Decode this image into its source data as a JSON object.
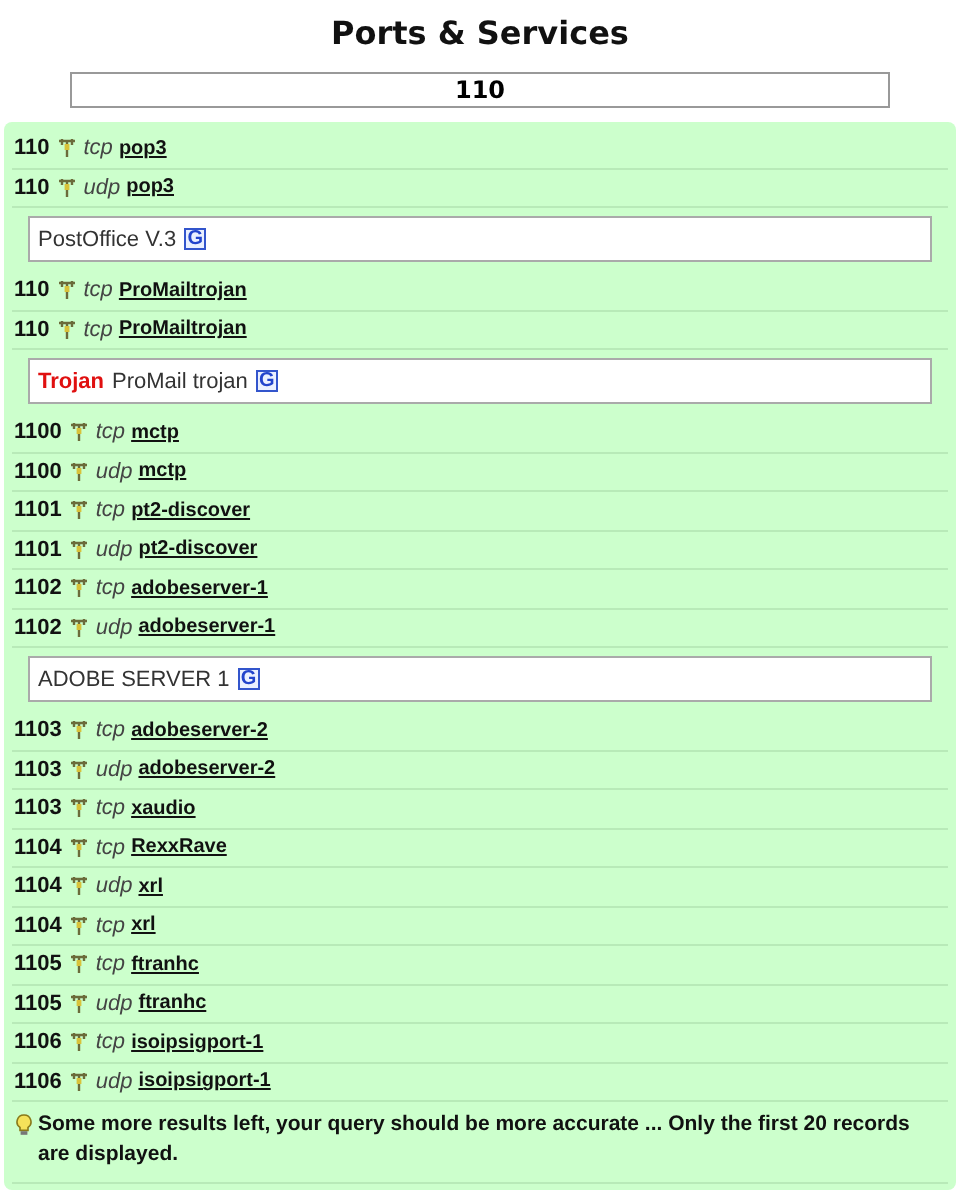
{
  "title": "Ports & Services",
  "search": {
    "value": "110"
  },
  "records": [
    {
      "port": "110",
      "protocol": "tcp",
      "service": "pop3"
    },
    {
      "port": "110",
      "protocol": "udp",
      "service": "pop3",
      "description": {
        "text": "PostOffice V.3",
        "link": "G"
      }
    },
    {
      "port": "110",
      "protocol": "tcp",
      "service": "ProMailtrojan"
    },
    {
      "port": "110",
      "protocol": "tcp",
      "service": "ProMailtrojan",
      "description": {
        "tag": "Trojan",
        "text": "ProMail trojan",
        "link": "G"
      }
    },
    {
      "port": "1100",
      "protocol": "tcp",
      "service": "mctp"
    },
    {
      "port": "1100",
      "protocol": "udp",
      "service": "mctp"
    },
    {
      "port": "1101",
      "protocol": "tcp",
      "service": "pt2-discover"
    },
    {
      "port": "1101",
      "protocol": "udp",
      "service": "pt2-discover"
    },
    {
      "port": "1102",
      "protocol": "tcp",
      "service": "adobeserver-1"
    },
    {
      "port": "1102",
      "protocol": "udp",
      "service": "adobeserver-1",
      "description": {
        "text": "ADOBE SERVER 1",
        "link": "G"
      }
    },
    {
      "port": "1103",
      "protocol": "tcp",
      "service": "adobeserver-2"
    },
    {
      "port": "1103",
      "protocol": "udp",
      "service": "adobeserver-2"
    },
    {
      "port": "1103",
      "protocol": "tcp",
      "service": "xaudio"
    },
    {
      "port": "1104",
      "protocol": "tcp",
      "service": "RexxRave"
    },
    {
      "port": "1104",
      "protocol": "udp",
      "service": "xrl"
    },
    {
      "port": "1104",
      "protocol": "tcp",
      "service": "xrl"
    },
    {
      "port": "1105",
      "protocol": "tcp",
      "service": "ftranhc"
    },
    {
      "port": "1105",
      "protocol": "udp",
      "service": "ftranhc"
    },
    {
      "port": "1106",
      "protocol": "tcp",
      "service": "isoipsigport-1"
    },
    {
      "port": "1106",
      "protocol": "udp",
      "service": "isoipsigport-1"
    }
  ],
  "notice": "Some more results left, your query should be more accurate ... Only the first 20 records are displayed."
}
